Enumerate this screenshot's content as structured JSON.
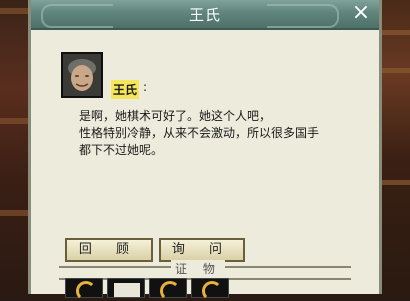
{
  "window": {
    "title": "王氏"
  },
  "speaker": {
    "name": "王氏",
    "colon": ":"
  },
  "dialog": {
    "text": "是啊，她棋术可好了。她这个人吧，\n性格特别冷静，从来不会激动，所以很多国手\n都下不过她呢。"
  },
  "buttons": {
    "review": "回 顾",
    "ask": "询 问"
  },
  "evidence": {
    "label": "证 物"
  },
  "icons": {
    "close": "close-icon",
    "portrait": "old-woman-portrait",
    "item": "hook-item-icon"
  },
  "colors": {
    "title_bar": "#5f857c",
    "panel": "#ecebdc",
    "name_highlight": "#f4e65a",
    "item_hook": "#e8b23a"
  }
}
